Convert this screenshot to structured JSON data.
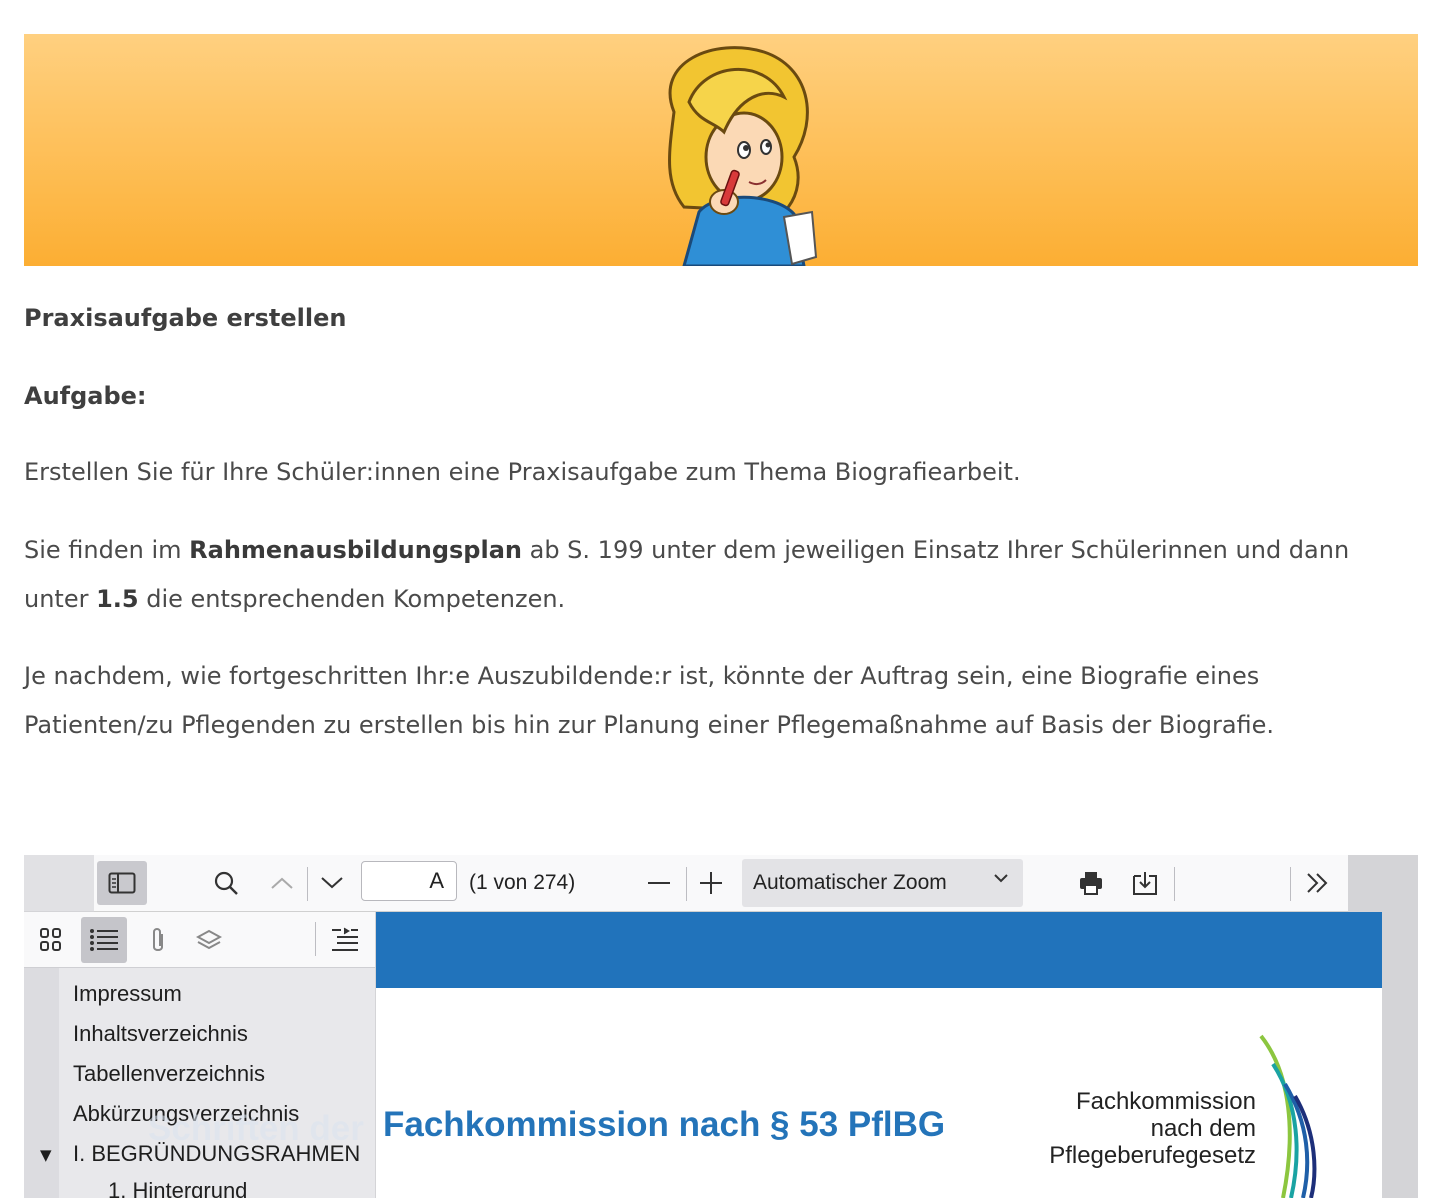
{
  "content": {
    "heading": "Praxisaufgabe erstellen",
    "task_label": "Aufgabe:",
    "p1": "Erstellen Sie für Ihre Schüler:innen eine Praxisaufgabe zum Thema Biografiearbeit.",
    "p2_part1": "Sie finden im ",
    "p2_bold1": "Rahmenausbildungsplan",
    "p2_part2": " ab S. 199 unter dem jeweiligen Einsatz Ihrer Schülerinnen und dann",
    "p2_part3": "unter ",
    "p2_bold2": "1.5",
    "p2_part4": " die entsprechenden Kompetenzen.",
    "p3_line1": "Je nachdem, wie fortgeschritten Ihr:e Auszubildende:r ist, könnte der Auftrag sein, eine Biografie eines",
    "p3_line2": "Patienten/zu Pflegenden zu erstellen bis hin zur Planung einer Pflegemaßnahme auf Basis der Biografie."
  },
  "viewer": {
    "page_input_value": "A",
    "page_count": "(1 von 274)",
    "zoom": "Automatischer Zoom",
    "outline": [
      "Impressum",
      "Inhaltsverzeichnis",
      "Tabellenverzeichnis",
      "Abkürzungsverzeichnis",
      "I. BEGRÜNDUNGSRAHMEN",
      "1. Hintergrund"
    ],
    "pdf_ghost_title": "Schriften der",
    "pdf_title": "Fachkommission nach § 53 PflBG",
    "pdf_logo_line1": "Fachkommission",
    "pdf_logo_line2": "nach dem",
    "pdf_logo_line3": "Pflegeberufegesetz"
  },
  "icons": {
    "sidebar_toggle": "sidebar-toggle-icon",
    "search": "search-icon",
    "prev": "chevron-up-icon",
    "next": "chevron-down-icon",
    "print": "print-icon",
    "download": "download-icon",
    "more": "double-chevron-right-icon"
  },
  "colors": {
    "banner": "#fcae33",
    "pdf_header": "#2173bb",
    "pdf_title": "#2474b9"
  }
}
